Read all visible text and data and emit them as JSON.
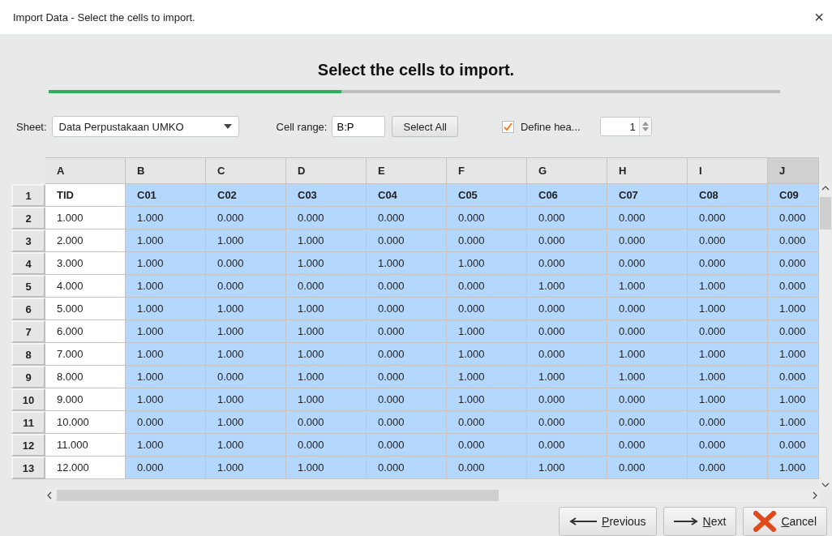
{
  "window": {
    "title": "Import Data - Select the cells to import.",
    "close": "×"
  },
  "heading": "Select the cells to import.",
  "progress": {
    "level": 0.4
  },
  "toolbar": {
    "sheet_label": "Sheet:",
    "sheet_value": "Data Perpustakaan UMKO",
    "range_label": "Cell range:",
    "range_value": "B:P",
    "select_all": "Select All",
    "define_header": {
      "label": "Define hea...",
      "checked": true
    },
    "header_rows": "1"
  },
  "table": {
    "columns": [
      {
        "label": "A",
        "selected": false,
        "focused": false
      },
      {
        "label": "B",
        "selected": true,
        "focused": false
      },
      {
        "label": "C",
        "selected": true,
        "focused": false
      },
      {
        "label": "D",
        "selected": true,
        "focused": false
      },
      {
        "label": "E",
        "selected": true,
        "focused": false
      },
      {
        "label": "F",
        "selected": true,
        "focused": false
      },
      {
        "label": "G",
        "selected": true,
        "focused": false
      },
      {
        "label": "H",
        "selected": true,
        "focused": false
      },
      {
        "label": "I",
        "selected": true,
        "focused": false
      },
      {
        "label": "J",
        "selected": true,
        "focused": true
      }
    ],
    "rows": [
      {
        "number": "1",
        "header": true,
        "cells": [
          "TID",
          "C01",
          "C02",
          "C03",
          "C04",
          "C05",
          "C06",
          "C07",
          "C08",
          "C09"
        ]
      },
      {
        "number": "2",
        "header": false,
        "cells": [
          "1.000",
          "1.000",
          "0.000",
          "0.000",
          "0.000",
          "0.000",
          "0.000",
          "0.000",
          "0.000",
          "0.000"
        ]
      },
      {
        "number": "3",
        "header": false,
        "cells": [
          "2.000",
          "1.000",
          "1.000",
          "1.000",
          "0.000",
          "0.000",
          "0.000",
          "0.000",
          "0.000",
          "0.000"
        ]
      },
      {
        "number": "4",
        "header": false,
        "cells": [
          "3.000",
          "1.000",
          "0.000",
          "1.000",
          "1.000",
          "1.000",
          "0.000",
          "0.000",
          "0.000",
          "0.000"
        ]
      },
      {
        "number": "5",
        "header": false,
        "cells": [
          "4.000",
          "1.000",
          "0.000",
          "0.000",
          "0.000",
          "0.000",
          "1.000",
          "1.000",
          "1.000",
          "0.000"
        ]
      },
      {
        "number": "6",
        "header": false,
        "cells": [
          "5.000",
          "1.000",
          "1.000",
          "1.000",
          "0.000",
          "0.000",
          "0.000",
          "0.000",
          "1.000",
          "1.000"
        ]
      },
      {
        "number": "7",
        "header": false,
        "cells": [
          "6.000",
          "1.000",
          "1.000",
          "1.000",
          "0.000",
          "1.000",
          "0.000",
          "0.000",
          "0.000",
          "0.000"
        ]
      },
      {
        "number": "8",
        "header": false,
        "cells": [
          "7.000",
          "1.000",
          "1.000",
          "1.000",
          "0.000",
          "1.000",
          "0.000",
          "1.000",
          "1.000",
          "1.000"
        ]
      },
      {
        "number": "9",
        "header": false,
        "cells": [
          "8.000",
          "1.000",
          "0.000",
          "1.000",
          "0.000",
          "1.000",
          "1.000",
          "1.000",
          "1.000",
          "0.000"
        ]
      },
      {
        "number": "10",
        "header": false,
        "cells": [
          "9.000",
          "1.000",
          "1.000",
          "1.000",
          "0.000",
          "1.000",
          "0.000",
          "0.000",
          "1.000",
          "1.000"
        ]
      },
      {
        "number": "11",
        "header": false,
        "cells": [
          "10.000",
          "0.000",
          "1.000",
          "0.000",
          "0.000",
          "0.000",
          "0.000",
          "0.000",
          "0.000",
          "1.000"
        ]
      },
      {
        "number": "12",
        "header": false,
        "cells": [
          "11.000",
          "1.000",
          "1.000",
          "0.000",
          "0.000",
          "0.000",
          "0.000",
          "0.000",
          "0.000",
          "0.000"
        ]
      },
      {
        "number": "13",
        "header": false,
        "cells": [
          "12.000",
          "0.000",
          "1.000",
          "1.000",
          "0.000",
          "0.000",
          "1.000",
          "0.000",
          "0.000",
          "1.000"
        ]
      }
    ]
  },
  "buttons": [
    {
      "kind": "previous",
      "label": "Previous"
    },
    {
      "kind": "next",
      "label": "Next"
    },
    {
      "kind": "cancel",
      "label": "Cancel"
    }
  ]
}
